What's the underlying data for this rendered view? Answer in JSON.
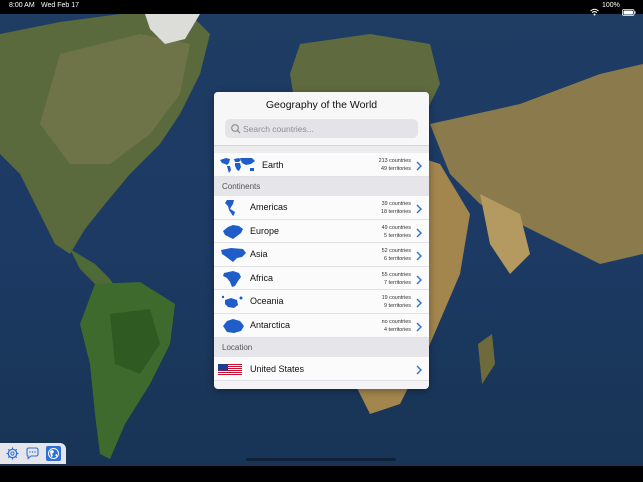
{
  "status_bar": {
    "time": "8:00 AM",
    "date": "Wed Feb 17",
    "battery": "100%",
    "wifi_icon": "wifi-icon",
    "battery_icon": "battery-icon"
  },
  "panel": {
    "title": "Geography of the World",
    "search_placeholder": "Search countries...",
    "earth": {
      "label": "Earth",
      "countries": "213 countries",
      "territories": "49 territories"
    },
    "continents_header": "Continents",
    "continents": [
      {
        "label": "Americas",
        "countries": "39 countries",
        "territories": "18 territories"
      },
      {
        "label": "Europe",
        "countries": "49 countries",
        "territories": "5 territories"
      },
      {
        "label": "Asia",
        "countries": "52 countries",
        "territories": "6 territories"
      },
      {
        "label": "Africa",
        "countries": "55 countries",
        "territories": "7 territories"
      },
      {
        "label": "Oceania",
        "countries": "19 countries",
        "territories": "9 territories"
      },
      {
        "label": "Antarctica",
        "countries": "no countries",
        "territories": "4 territories"
      }
    ],
    "location_header": "Location",
    "location": {
      "label": "United States"
    }
  },
  "toolbar": {
    "settings_icon": "gear-icon",
    "chat_icon": "chat-bubble-icon",
    "globe_icon": "globe-icon"
  },
  "colors": {
    "accent": "#2f6fd8",
    "continent_blue": "#1f5ec9",
    "ocean": "#1d3a62"
  }
}
